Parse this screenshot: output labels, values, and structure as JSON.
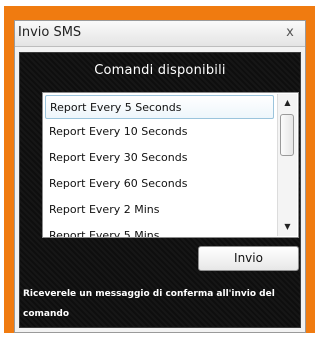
{
  "window": {
    "title": "Invio SMS",
    "close_glyph": "x"
  },
  "panel": {
    "heading": "Comandi disponibili",
    "commands": [
      {
        "label": "Report Every 5 Seconds"
      },
      {
        "label": "Report Every 10 Seconds"
      },
      {
        "label": "Report Every 30 Seconds"
      },
      {
        "label": "Report Every 60 Seconds"
      },
      {
        "label": "Report Every 2 Mins"
      },
      {
        "label": "Report Every 5 Mins"
      }
    ],
    "selected_command": "Report Every 5 Seconds",
    "scroll_up_glyph": "▲",
    "scroll_down_glyph": "▼",
    "send_label": "Invio",
    "confirm_label": "Riceverele un messaggio di conferma all'invio del comando"
  },
  "colors": {
    "frame_accent": "#f07b10",
    "panel_background": "#111111"
  }
}
